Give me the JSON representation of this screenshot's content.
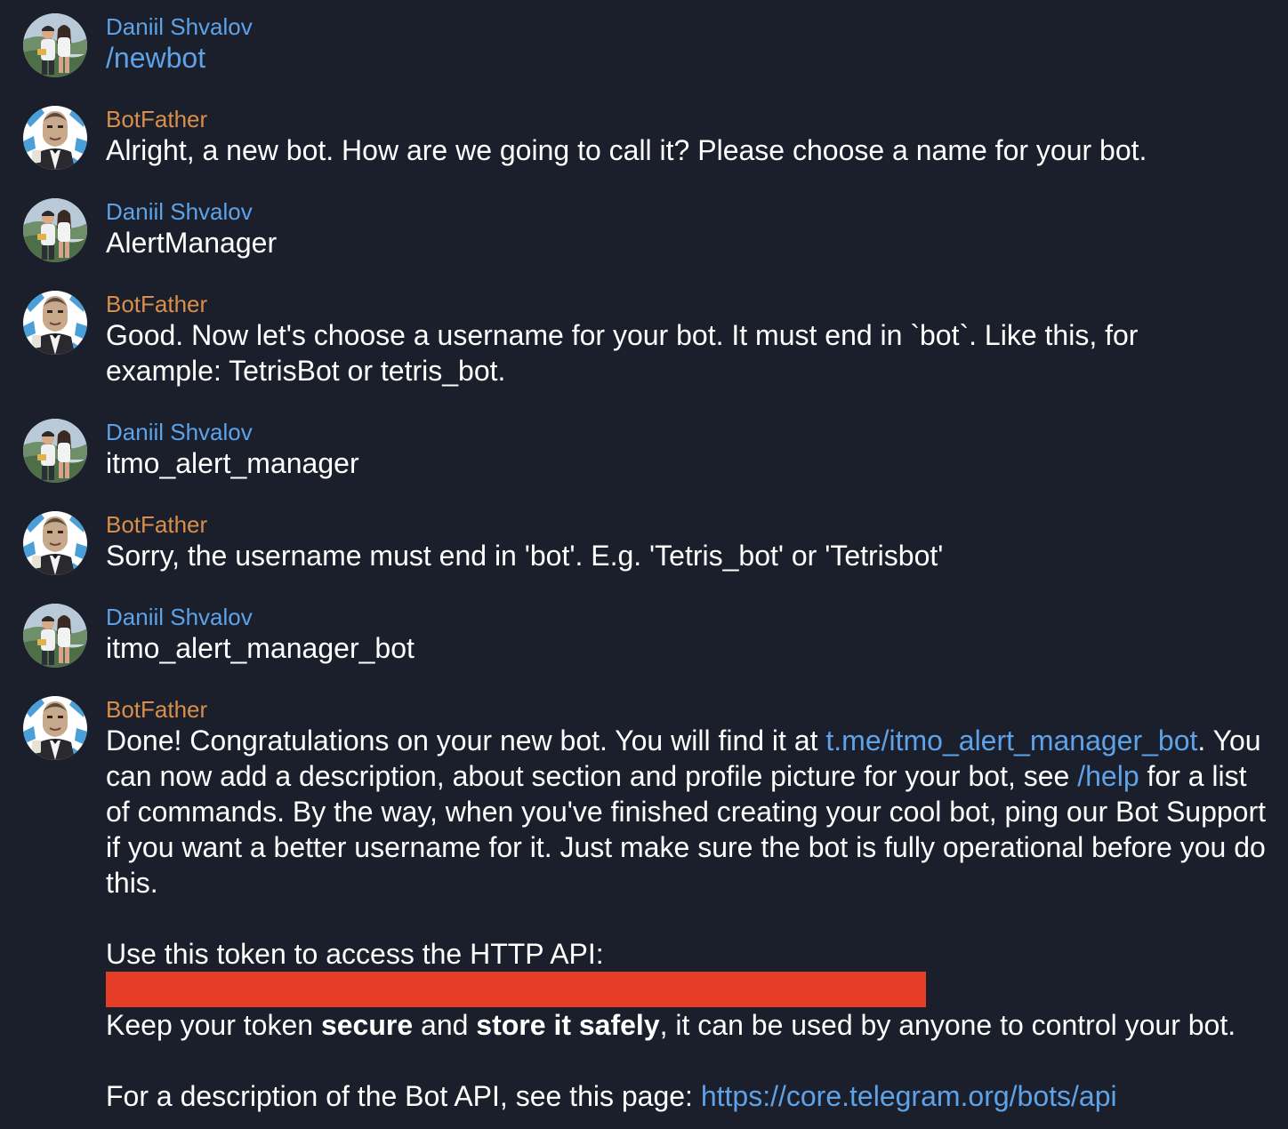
{
  "colors": {
    "background": "#1b1f2b",
    "user_name": "#5ea2e8",
    "bot_name": "#d98e4a",
    "link": "#5ea2e8",
    "text": "#ffffff",
    "redaction": "#e63d29"
  },
  "messages": [
    {
      "author": "Daniil Shvalov",
      "role": "user",
      "text": "/newbot"
    },
    {
      "author": "BotFather",
      "role": "bot",
      "text": "Alright, a new bot. How are we going to call it? Please choose a name for your bot."
    },
    {
      "author": "Daniil Shvalov",
      "role": "user",
      "text": "AlertManager"
    },
    {
      "author": "BotFather",
      "role": "bot",
      "text": "Good. Now let's choose a username for your bot. It must end in `bot`. Like this, for example: TetrisBot or tetris_bot."
    },
    {
      "author": "Daniil Shvalov",
      "role": "user",
      "text": "itmo_alert_manager"
    },
    {
      "author": "BotFather",
      "role": "bot",
      "text": "Sorry, the username must end in 'bot'. E.g. 'Tetris_bot' or 'Tetrisbot'"
    },
    {
      "author": "Daniil Shvalov",
      "role": "user",
      "text": "itmo_alert_manager_bot"
    },
    {
      "author": "BotFather",
      "role": "bot",
      "done_intro": "Done! Congratulations on your new bot. You will find it at ",
      "bot_link": "t.me/itmo_alert_manager_bot",
      "after_link": ". You can now add a description, about section and profile picture for your bot, see ",
      "help_link": "/help",
      "after_help": " for a list of commands. By the way, when you've finished creating your cool bot, ping our Bot Support if you want a better username for it. Just make sure the bot is fully operational before you do this.",
      "token_intro": "Use this token to access the HTTP API:",
      "keep_1": "Keep your token ",
      "keep_bold_1": "secure",
      "keep_2": " and ",
      "keep_bold_2": "store it safely",
      "keep_3": ", it can be used by anyone to control your bot.",
      "api_intro": "For a description of the Bot API, see this page: ",
      "api_link": "https://core.telegram.org/bots/api"
    }
  ]
}
